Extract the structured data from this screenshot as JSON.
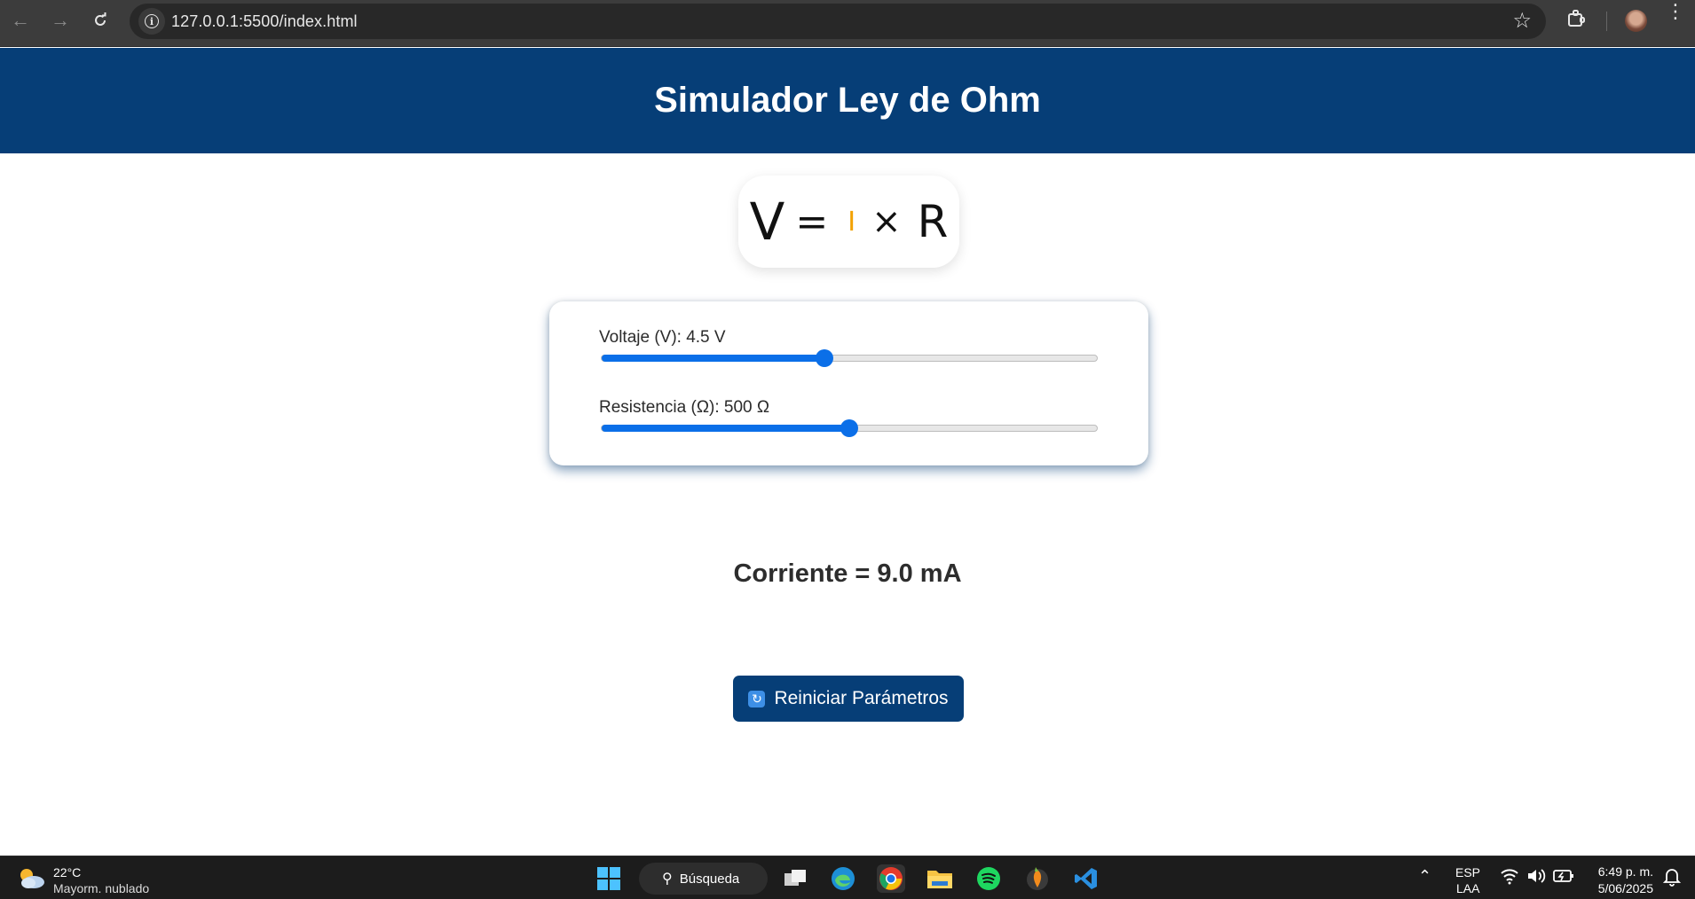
{
  "browser": {
    "url": "127.0.0.1:5500/index.html",
    "back_icon": "arrow-left-icon",
    "forward_icon": "arrow-right-icon",
    "reload_icon": "reload-icon"
  },
  "page": {
    "title": "Simulador Ley de Ohm",
    "formula": {
      "v": "V",
      "eq": "=",
      "i": "I",
      "times": "×",
      "r": "R"
    },
    "controls": {
      "voltage": {
        "label": "Voltaje (V): 4.5 V",
        "level": 0.45
      },
      "resistance": {
        "label": "Resistencia (Ω): 500 Ω",
        "level": 0.5
      }
    },
    "result": "Corriente = 9.0 mA",
    "reset_button": "Reiniciar Parámetros",
    "reset_icon_glyph": "🔄"
  },
  "taskbar": {
    "weather_temp": "22°C",
    "weather_desc": "Mayorm. nublado",
    "search_label": "Búsqueda",
    "lang_top": "ESP",
    "lang_bottom": "LAA",
    "time": "6:49 p. m.",
    "date": "5/06/2025"
  }
}
